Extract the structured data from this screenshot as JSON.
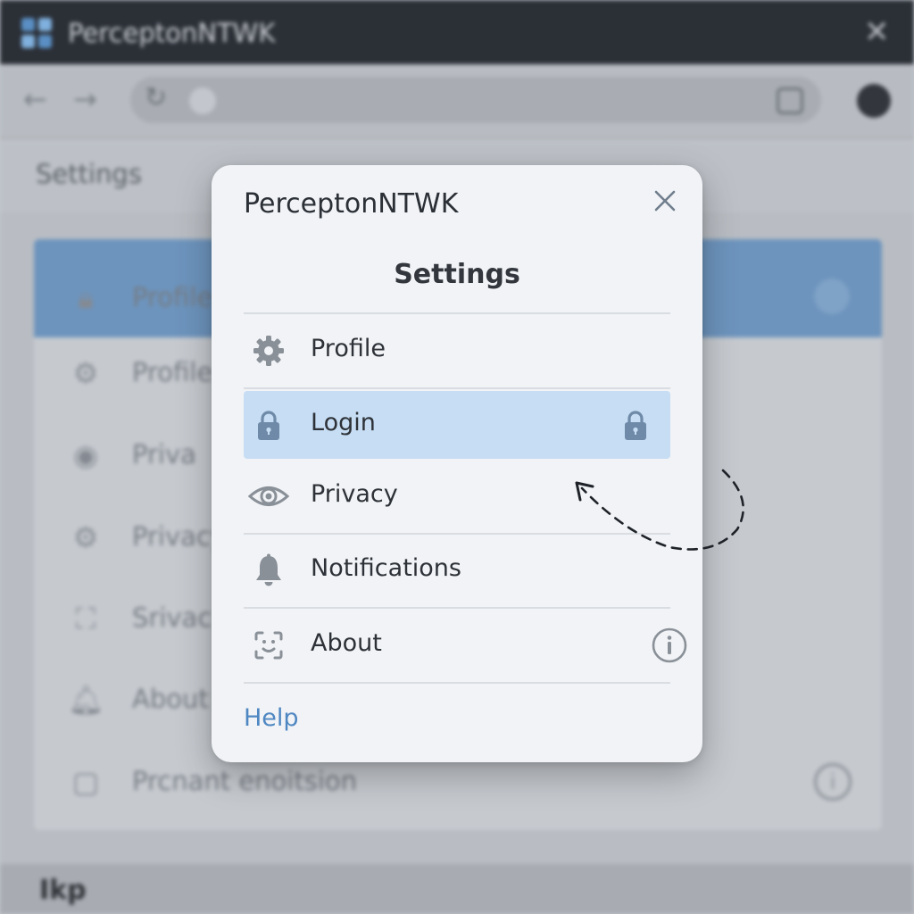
{
  "app": {
    "title": "PerceptonNTWK"
  },
  "background": {
    "header_title": "Settings",
    "rows": [
      {
        "label": "Profile",
        "icon": "lock-icon"
      },
      {
        "label": "Profile",
        "icon": "gear-icon"
      },
      {
        "label": "Priva",
        "icon": "eye-icon"
      },
      {
        "label": "Privacy",
        "icon": "gear-icon"
      },
      {
        "label": "Srivac",
        "icon": "face-scan-icon"
      },
      {
        "label": "About",
        "icon": "bell-icon"
      },
      {
        "label": "Prcnant enoitsion",
        "icon": "square-icon"
      }
    ],
    "footer_logo": "Ikp"
  },
  "modal": {
    "app_title": "PerceptonNTWK",
    "title": "Settings",
    "items": [
      {
        "label": "Profile",
        "icon": "gear-icon",
        "trailing_icon": "",
        "selected": false
      },
      {
        "label": "Login",
        "icon": "lock-icon",
        "trailing_icon": "lock-icon",
        "selected": true
      },
      {
        "label": "Privacy",
        "icon": "eye-icon",
        "trailing_icon": "",
        "selected": false
      },
      {
        "label": "Notifications",
        "icon": "bell-icon",
        "trailing_icon": "",
        "selected": false
      },
      {
        "label": "About",
        "icon": "face-scan-icon",
        "trailing_icon": "info-icon",
        "selected": false
      }
    ],
    "help_label": "Help"
  },
  "colors": {
    "selected_row": "#c6ddf3",
    "accent_link": "#4f87c2",
    "icon_gray": "#8a9098",
    "lock_blue": "#6f8aa8",
    "titlebar": "#2b2f36"
  }
}
